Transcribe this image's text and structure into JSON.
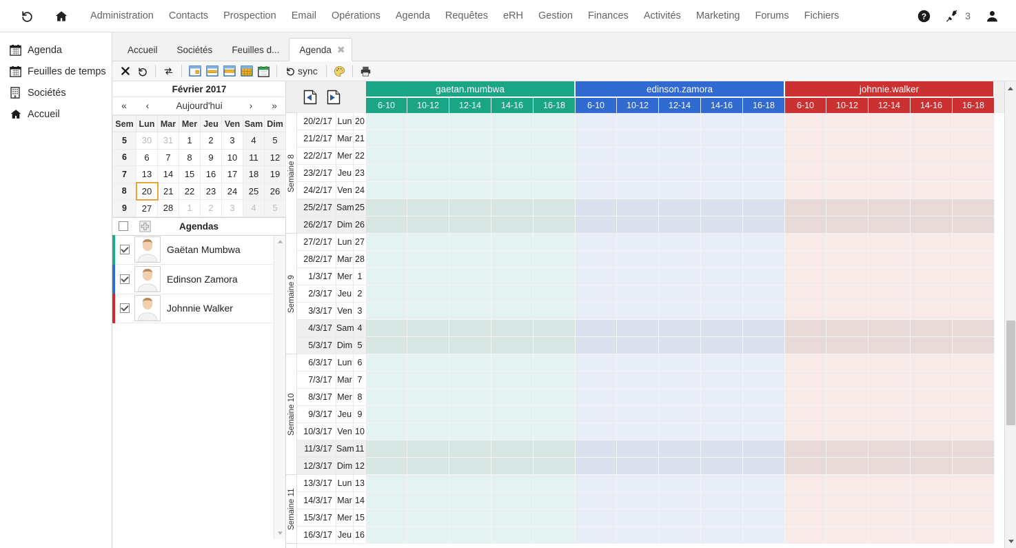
{
  "topnav": {
    "links": [
      "Administration",
      "Contacts",
      "Prospection",
      "Email",
      "Opérations",
      "Agenda",
      "Requêtes",
      "eRH",
      "Gestion",
      "Finances",
      "Activités",
      "Marketing",
      "Forums",
      "Fichiers"
    ],
    "history_icon": "history-icon",
    "home_icon": "home-icon",
    "help_icon": "help-icon",
    "plug_icon": "plug-icon",
    "plug_count": "3",
    "user_icon": "user-avatar-icon"
  },
  "sidebar": {
    "items": [
      {
        "label": "Agenda",
        "icon": "calendar-icon"
      },
      {
        "label": "Feuilles de temps",
        "icon": "timesheet-calendar-icon"
      },
      {
        "label": "Sociétés",
        "icon": "building-icon"
      },
      {
        "label": "Accueil",
        "icon": "home-icon"
      }
    ]
  },
  "tabs": {
    "items": [
      {
        "label": "Accueil",
        "active": false
      },
      {
        "label": "Sociétés",
        "active": false
      },
      {
        "label": "Feuilles d...",
        "active": false
      },
      {
        "label": "Agenda",
        "active": true
      }
    ],
    "close_glyph": "✖"
  },
  "toolbar": {
    "buttons": [
      {
        "name": "delete-button",
        "icon": "x-bold-icon"
      },
      {
        "name": "undo-button",
        "icon": "undo-arrow-icon"
      },
      {
        "name": "transfer-button",
        "icon": "swap-arrows-icon"
      },
      {
        "name": "view-day-button",
        "icon": "calendar-day-view-icon"
      },
      {
        "name": "view-week-button",
        "icon": "calendar-week-view-icon"
      },
      {
        "name": "view-workweek-button",
        "icon": "calendar-workweek-view-icon"
      },
      {
        "name": "view-month-button",
        "icon": "calendar-month-view-icon"
      },
      {
        "name": "new-event-button",
        "icon": "calendar-green-icon"
      }
    ],
    "sync_label": "sync",
    "sync_icon": "sync-arrow-icon",
    "palette_icon": "palette-icon",
    "print_icon": "printer-icon"
  },
  "minicalendar": {
    "title": "Février 2017",
    "nav": {
      "first": "«",
      "prev": "‹",
      "today": "Aujourd'hui",
      "next": "›",
      "last": "»"
    },
    "headers": [
      "Sem",
      "Lun",
      "Mar",
      "Mer",
      "Jeu",
      "Ven",
      "Sam",
      "Dim"
    ],
    "weeks": [
      {
        "sem": "5",
        "days": [
          {
            "d": "30",
            "other": true,
            "we": false,
            "sel": false
          },
          {
            "d": "31",
            "other": true,
            "we": false,
            "sel": false
          },
          {
            "d": "1",
            "other": false,
            "we": false,
            "sel": false
          },
          {
            "d": "2",
            "other": false,
            "we": false,
            "sel": false
          },
          {
            "d": "3",
            "other": false,
            "we": false,
            "sel": false
          },
          {
            "d": "4",
            "other": false,
            "we": true,
            "sel": false
          },
          {
            "d": "5",
            "other": false,
            "we": true,
            "sel": false
          }
        ]
      },
      {
        "sem": "6",
        "days": [
          {
            "d": "6",
            "other": false,
            "we": false,
            "sel": false
          },
          {
            "d": "7",
            "other": false,
            "we": false,
            "sel": false
          },
          {
            "d": "8",
            "other": false,
            "we": false,
            "sel": false
          },
          {
            "d": "9",
            "other": false,
            "we": false,
            "sel": false
          },
          {
            "d": "10",
            "other": false,
            "we": false,
            "sel": false
          },
          {
            "d": "11",
            "other": false,
            "we": true,
            "sel": false
          },
          {
            "d": "12",
            "other": false,
            "we": true,
            "sel": false
          }
        ]
      },
      {
        "sem": "7",
        "days": [
          {
            "d": "13",
            "other": false,
            "we": false,
            "sel": false
          },
          {
            "d": "14",
            "other": false,
            "we": false,
            "sel": false
          },
          {
            "d": "15",
            "other": false,
            "we": false,
            "sel": false
          },
          {
            "d": "16",
            "other": false,
            "we": false,
            "sel": false
          },
          {
            "d": "17",
            "other": false,
            "we": false,
            "sel": false
          },
          {
            "d": "18",
            "other": false,
            "we": true,
            "sel": false
          },
          {
            "d": "19",
            "other": false,
            "we": true,
            "sel": false
          }
        ]
      },
      {
        "sem": "8",
        "days": [
          {
            "d": "20",
            "other": false,
            "we": false,
            "sel": true
          },
          {
            "d": "21",
            "other": false,
            "we": false,
            "sel": false
          },
          {
            "d": "22",
            "other": false,
            "we": false,
            "sel": false
          },
          {
            "d": "23",
            "other": false,
            "we": false,
            "sel": false
          },
          {
            "d": "24",
            "other": false,
            "we": false,
            "sel": false
          },
          {
            "d": "25",
            "other": false,
            "we": true,
            "sel": false
          },
          {
            "d": "26",
            "other": false,
            "we": true,
            "sel": false
          }
        ]
      },
      {
        "sem": "9",
        "days": [
          {
            "d": "27",
            "other": false,
            "we": false,
            "sel": false
          },
          {
            "d": "28",
            "other": false,
            "we": false,
            "sel": false
          },
          {
            "d": "1",
            "other": true,
            "we": false,
            "sel": false
          },
          {
            "d": "2",
            "other": true,
            "we": false,
            "sel": false
          },
          {
            "d": "3",
            "other": true,
            "we": false,
            "sel": false
          },
          {
            "d": "4",
            "other": true,
            "we": true,
            "sel": false
          },
          {
            "d": "5",
            "other": true,
            "we": true,
            "sel": false
          }
        ]
      }
    ]
  },
  "agendas": {
    "header_title": "Agendas",
    "add_icon": "add-plus-icon",
    "rows": [
      {
        "name": "Gaëtan Mumbwa",
        "color": "#1cab8b",
        "checked": true
      },
      {
        "name": "Edinson Zamora",
        "color": "#2b6fd4",
        "checked": true
      },
      {
        "name": "Johnnie Walker",
        "color": "#d02b2b",
        "checked": true
      }
    ]
  },
  "calendar": {
    "prev_page_icon": "page-previous-icon",
    "next_page_icon": "page-next-icon",
    "slots": [
      "6-10",
      "10-12",
      "12-14",
      "14-16",
      "16-18"
    ],
    "users": [
      {
        "login": "gaetan.mumbwa",
        "color": "#1aa585",
        "cell_weekday": "#e4f3f1",
        "cell_weekend": "#d7e6e2"
      },
      {
        "login": "edinson.zamora",
        "color": "#3069cf",
        "cell_weekday": "#e9edf7",
        "cell_weekend": "#dbe0ed"
      },
      {
        "login": "johnnie.walker",
        "color": "#cc3131",
        "cell_weekday": "#f9eaea",
        "cell_weekend": "#e8d9d9"
      }
    ],
    "weeks": [
      {
        "label": "Semaine 8",
        "rows": [
          {
            "date": "20/2/17",
            "dow": "Lun",
            "num": "20",
            "we": false
          },
          {
            "date": "21/2/17",
            "dow": "Mar",
            "num": "21",
            "we": false
          },
          {
            "date": "22/2/17",
            "dow": "Mer",
            "num": "22",
            "we": false
          },
          {
            "date": "23/2/17",
            "dow": "Jeu",
            "num": "23",
            "we": false
          },
          {
            "date": "24/2/17",
            "dow": "Ven",
            "num": "24",
            "we": false
          },
          {
            "date": "25/2/17",
            "dow": "Sam",
            "num": "25",
            "we": true
          },
          {
            "date": "26/2/17",
            "dow": "Dim",
            "num": "26",
            "we": true
          }
        ]
      },
      {
        "label": "Semaine 9",
        "rows": [
          {
            "date": "27/2/17",
            "dow": "Lun",
            "num": "27",
            "we": false
          },
          {
            "date": "28/2/17",
            "dow": "Mar",
            "num": "28",
            "we": false
          },
          {
            "date": "1/3/17",
            "dow": "Mer",
            "num": "1",
            "we": false
          },
          {
            "date": "2/3/17",
            "dow": "Jeu",
            "num": "2",
            "we": false
          },
          {
            "date": "3/3/17",
            "dow": "Ven",
            "num": "3",
            "we": false
          },
          {
            "date": "4/3/17",
            "dow": "Sam",
            "num": "4",
            "we": true
          },
          {
            "date": "5/3/17",
            "dow": "Dim",
            "num": "5",
            "we": true
          }
        ]
      },
      {
        "label": "Semaine 10",
        "rows": [
          {
            "date": "6/3/17",
            "dow": "Lun",
            "num": "6",
            "we": false
          },
          {
            "date": "7/3/17",
            "dow": "Mar",
            "num": "7",
            "we": false
          },
          {
            "date": "8/3/17",
            "dow": "Mer",
            "num": "8",
            "we": false
          },
          {
            "date": "9/3/17",
            "dow": "Jeu",
            "num": "9",
            "we": false
          },
          {
            "date": "10/3/17",
            "dow": "Ven",
            "num": "10",
            "we": false
          },
          {
            "date": "11/3/17",
            "dow": "Sam",
            "num": "11",
            "we": true
          },
          {
            "date": "12/3/17",
            "dow": "Dim",
            "num": "12",
            "we": true
          }
        ]
      },
      {
        "label": "Semaine 11",
        "rows": [
          {
            "date": "13/3/17",
            "dow": "Lun",
            "num": "13",
            "we": false
          },
          {
            "date": "14/3/17",
            "dow": "Mar",
            "num": "14",
            "we": false
          },
          {
            "date": "15/3/17",
            "dow": "Mer",
            "num": "15",
            "we": false
          },
          {
            "date": "16/3/17",
            "dow": "Jeu",
            "num": "16",
            "we": false
          }
        ]
      }
    ]
  }
}
